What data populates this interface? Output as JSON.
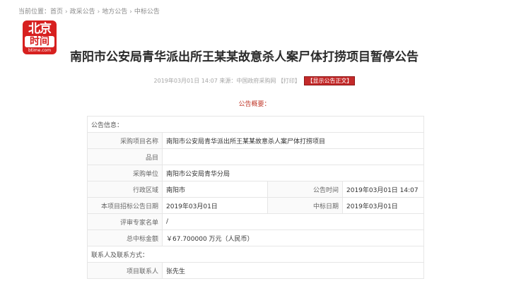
{
  "breadcrumb": {
    "prefix": "当前位置：",
    "items": [
      "首页",
      "政采公告",
      "地方公告",
      "中标公告"
    ],
    "separator": "›"
  },
  "logo": {
    "line1": "北京",
    "line2": "时间",
    "line3": "btime.com"
  },
  "title": "南阳市公安局青华派出所王某某故意杀人案尸体打捞项目暂停公告",
  "meta": {
    "datetime": "2019年03月01日 14:07",
    "source": "来源：中国政府采购网",
    "print_label": "【打印】",
    "show_label": "【显示公告正文】"
  },
  "summary_title": "公告概要：",
  "table": {
    "section_info": "公告信息：",
    "project_name_label": "采购项目名称",
    "project_name": "南阳市公安局青华派出所王某某故意杀人案尸体打捞项目",
    "items_label": "品目",
    "items_value": "",
    "purchaser_label": "采购单位",
    "purchaser": "南阳市公安局青华分局",
    "region_label": "行政区域",
    "region": "南阳市",
    "publish_time_label": "公告时间",
    "publish_time": "2019年03月01日 14:07",
    "bid_date_label": "本项目招标公告日期",
    "bid_date": "2019年03月01日",
    "award_date_label": "中标日期",
    "award_date": "2019年03月01日",
    "experts_label": "评审专家名单",
    "experts": "/",
    "amount_label": "总中标金额",
    "amount": "￥67.700000 万元（人民币）",
    "section_contact": "联系人及联系方式：",
    "contact_label": "项目联系人",
    "contact": "张先生"
  }
}
